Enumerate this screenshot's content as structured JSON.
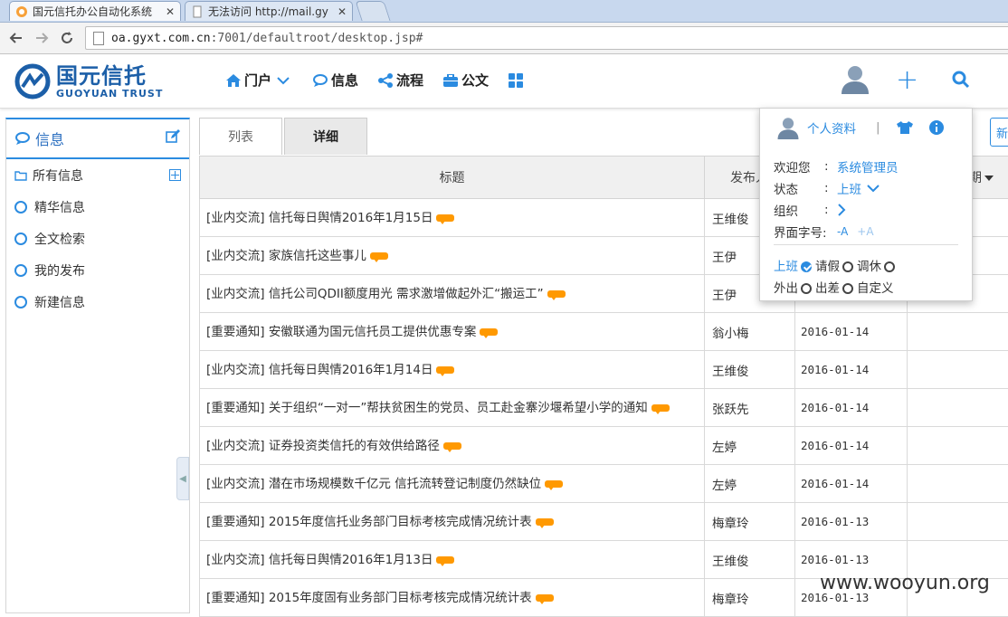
{
  "browser": {
    "tabs": [
      {
        "title": "国元信托办公自动化系统",
        "close": "✕"
      },
      {
        "title": "无法访问 http://mail.gy",
        "close": "✕"
      }
    ],
    "url_host": "oa.gyxt.com.cn",
    "url_rest": ":7001/defaultroot/desktop.jsp#"
  },
  "header": {
    "logo_cn": "国元信托",
    "logo_en": "GUOYUAN TRUST",
    "nav": [
      {
        "label": "门户",
        "icon": "home-icon"
      },
      {
        "label": "信息",
        "icon": "chat-icon"
      },
      {
        "label": "流程",
        "icon": "share-icon"
      },
      {
        "label": "公文",
        "icon": "briefcase-icon"
      }
    ]
  },
  "sidebar": {
    "title": "信息",
    "items": [
      "所有信息",
      "精华信息",
      "全文检索",
      "我的发布",
      "新建信息"
    ]
  },
  "view_tabs": [
    "列表",
    "详细"
  ],
  "new_button": "新",
  "table": {
    "columns": [
      "标题",
      "发布人",
      "",
      "期"
    ],
    "rows": [
      {
        "title": "[业内交流] 信托每日舆情2016年1月15日",
        "author": "王维俊",
        "date": ""
      },
      {
        "title": "[业内交流] 家族信托这些事儿",
        "author": "王伊",
        "date": ""
      },
      {
        "title": "[业内交流] 信托公司QDII额度用光 需求激增做起外汇“搬运工”",
        "author": "王伊",
        "date": ""
      },
      {
        "title": "[重要通知] 安徽联通为国元信托员工提供优惠专案",
        "author": "翁小梅",
        "date": "2016-01-14"
      },
      {
        "title": "[业内交流] 信托每日舆情2016年1月14日",
        "author": "王维俊",
        "date": "2016-01-14"
      },
      {
        "title": "[重要通知] 关于组织“一对一”帮扶贫困生的党员、员工赴金寨沙堰希望小学的通知",
        "author": "张跃先",
        "date": "2016-01-14"
      },
      {
        "title": "[业内交流] 证券投资类信托的有效供给路径",
        "author": "左婷",
        "date": "2016-01-14"
      },
      {
        "title": "[业内交流] 潜在市场规模数千亿元 信托流转登记制度仍然缺位",
        "author": "左婷",
        "date": "2016-01-14"
      },
      {
        "title": "[重要通知] 2015年度信托业务部门目标考核完成情况统计表",
        "author": "梅章玲",
        "date": "2016-01-13"
      },
      {
        "title": "[业内交流] 信托每日舆情2016年1月13日",
        "author": "王维俊",
        "date": "2016-01-13"
      },
      {
        "title": "[重要通知] 2015年度固有业务部门目标考核完成情况统计表",
        "author": "梅章玲",
        "date": "2016-01-13"
      }
    ]
  },
  "profile_popup": {
    "profile_link": "个人资料",
    "separator": "|",
    "welcome_label": "欢迎您",
    "welcome_value": "系统管理员",
    "status_label": "状态",
    "status_value": "上班",
    "org_label": "组织",
    "font_label": "界面字号:",
    "font_minus": "-A",
    "font_plus": "+A",
    "colon": ":",
    "statuses": [
      "上班",
      "请假",
      "调休",
      "外出",
      "出差",
      "自定义"
    ],
    "selected_status": "上班"
  },
  "watermark": "www.wooyun.org",
  "colors": {
    "accent": "#2b8be0",
    "brand": "#1c5fa8",
    "badge": "#ff9900"
  }
}
